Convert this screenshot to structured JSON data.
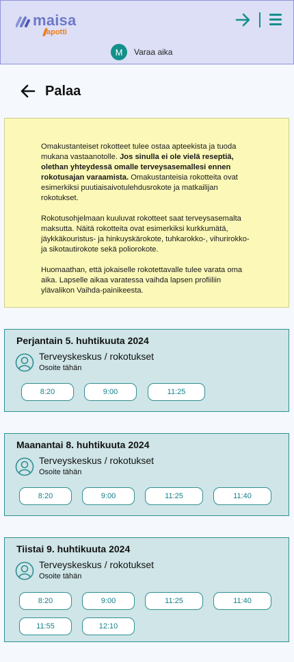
{
  "header": {
    "brand": "maisa",
    "sub_brand": "apotti",
    "login_icon": "arrow-right-icon",
    "menu_icon": "hamburger-menu-icon",
    "user": {
      "initial": "M",
      "label": "Varaa aika"
    },
    "colors": {
      "background": "#dcdff5",
      "accent": "#13908a",
      "brand": "#6f78c8",
      "sub_brand": "#ef7d1a"
    }
  },
  "back": {
    "icon": "arrow-left-icon",
    "label": "Palaa"
  },
  "notice": {
    "p1_normal_a": "Omakustanteiset rokotteet tulee ostaa apteekista ja tuoda mukana vastaanotolle. ",
    "p1_bold": "Jos sinulla ei ole vielä reseptiä, olethan yhteydessä omalle terveysasemallesi ennen rokotusajan varaamista.",
    "p1_normal_b": " Omakustanteisia rokotteita ovat esimerkiksi puutiaisaivotulehdusrokote ja matkailijan rokotukset.",
    "p2": "Rokotusohjelmaan kuuluvat rokotteet saat terveysasemalta maksutta. Näitä rokotteita ovat esimerkiksi kurkkumätä, jäykkäkouristus- ja hinkuyskärokote, tuhkarokko-, vihurirokko- ja sikotautirokote sekä poliorokote.",
    "p3": "Huomaathan, että jokaiselle rokotettavalle tulee varata oma aika. Lapselle aikaa varatessa vaihda lapsen profiiliin ylävalikon Vaihda-painikeesta.",
    "colors": {
      "background": "#fbf8b8"
    }
  },
  "days": [
    {
      "title": "Perjantain 5. huhtikuuta 2024",
      "place": "Terveyskeskus / rokotukset",
      "address": "Osoite tähän",
      "slots": [
        "8:20",
        "9:00",
        "11:25"
      ]
    },
    {
      "title": "Maanantai 8. huhtikuuta  2024",
      "place": "Terveyskeskus / rokotukset",
      "address": "Osoite tähän",
      "slots": [
        "8:20",
        "9:00",
        "11:25",
        "11:40"
      ]
    },
    {
      "title": "Tiistai 9. huhtikuuta 2024",
      "place": "Terveyskeskus / rokotukset",
      "address": "Osoite tähän",
      "slots": [
        "8:20",
        "9:00",
        "11:25",
        "11:40",
        "11:55",
        "12:10"
      ]
    }
  ],
  "card_colors": {
    "background": "#cfe5e7",
    "border": "#2f8f93",
    "slot_text": "#13808a"
  }
}
